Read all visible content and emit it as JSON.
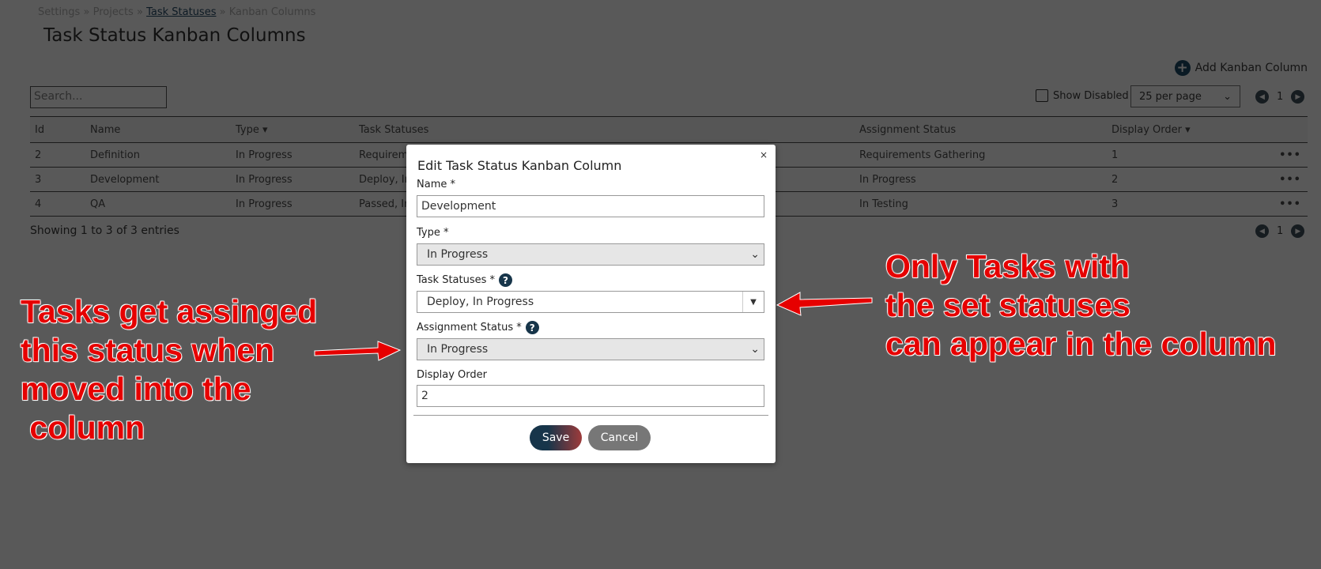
{
  "breadcrumb": {
    "items": [
      "Settings",
      "Projects",
      "Task Statuses",
      "Kanban Columns"
    ],
    "sep": "»"
  },
  "page_title": "Task Status Kanban Columns",
  "add_button": "Add Kanban Column",
  "search_placeholder": "Search...",
  "show_disabled": "Show Disabled",
  "per_page": "25 per page",
  "page": "1",
  "table": {
    "headers": [
      "Id",
      "Name",
      "Type ▾",
      "Task Statuses",
      "Assignment Status",
      "Display Order ▾"
    ],
    "rows": [
      [
        "2",
        "Definition",
        "In Progress",
        "Requireme",
        "Requirements Gathering",
        "1"
      ],
      [
        "3",
        "Development",
        "In Progress",
        "Deploy, In",
        "In Progress",
        "2"
      ],
      [
        "4",
        "QA",
        "In Progress",
        "Passed, In",
        "In Testing",
        "3"
      ]
    ]
  },
  "showing": "Showing 1 to 3 of 3 entries",
  "modal": {
    "title": "Edit Task Status Kanban Column",
    "close": "×",
    "name_label": "Name *",
    "name_value": "Development",
    "type_label": "Type *",
    "type_value": "In Progress",
    "statuses_label": "Task Statuses *",
    "statuses_value": "Deploy, In Progress",
    "assign_label": "Assignment Status *",
    "assign_value": "In Progress",
    "order_label": "Display Order",
    "order_value": "2",
    "save": "Save",
    "cancel": "Cancel"
  },
  "annotations": {
    "left": "Tasks get assinged\nthis status when\nmoved into the\n column",
    "right": "Only Tasks with\nthe set statuses\ncan appear in the column",
    "color": "#e60000"
  }
}
